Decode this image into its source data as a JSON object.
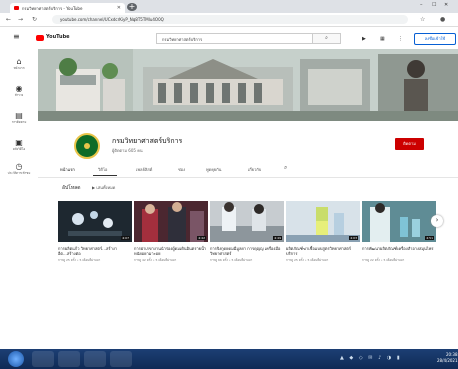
{
  "browser": {
    "tab_title": "กรมวิทยาศาสตร์บริการ - YouTube",
    "url": "youtube.com/channel/UCxdcrKiyP_Nq8T5TMlu4O0Q"
  },
  "youtube": {
    "logo_text": "YouTube",
    "search_value": "กรมวิทยาศาสตร์บริการ",
    "signin_label": "ลงชื่อเข้าใช้"
  },
  "sidebar": {
    "items": [
      {
        "label": "หน้าแรก",
        "icon": "home-icon"
      },
      {
        "label": "สำรวจ",
        "icon": "explore-icon"
      },
      {
        "label": "การติดตาม",
        "icon": "subscriptions-icon"
      },
      {
        "label": "คลังวิดีโอ",
        "icon": "library-icon"
      },
      {
        "label": "ประวัติการเข้าชม",
        "icon": "history-icon"
      }
    ]
  },
  "channel": {
    "name": "กรมวิทยาศาสตร์บริการ",
    "subscribers": "ผู้ติดตาม 605 คน",
    "subscribe_label": "ติดตาม",
    "brand_color": "#cc0000"
  },
  "tabs": [
    "หน้าแรก",
    "วิดีโอ",
    "เพลย์ลิสต์",
    "ช่อง",
    "พูดคุยกัน",
    "เกี่ยวกับ"
  ],
  "section": {
    "title": "อัปโหลด",
    "play_all": "เล่นทั้งหมด"
  },
  "videos": [
    {
      "title": "การผลิตแก้ว วิทยาศาสตร์...สร้างาอีต...สร้างต่อ",
      "duration": "4:07",
      "meta": "การดู 25 ครั้ง • 5 เดือนที่ผ่านมา"
    },
    {
      "title": "การผ่าเรขางานนำร่องผู้ดมเดินอินตรายน้ำหนัยอยามาะอย",
      "duration": "4:42",
      "meta": "การดู 42 ครั้ง • 5 เดือนที่ผ่านมา"
    },
    {
      "title": "การจิงกุดยดมมีมูลยา การดุญญ เครื่องมือวิทยาศาสตร์",
      "duration": "4:49",
      "meta": "การดู 66 ครั้ง • 5 เดือนที่ผ่านมา"
    },
    {
      "title": "ผลิตภัณฑ์ฆ่าเชื้อแบบสูตรวิทยาศาสตร์บริการ",
      "duration": "4:03",
      "meta": "การดู 25 ครั้ง • 5 เดือนที่ผ่านมา"
    },
    {
      "title": "การพัฒนาผลิตภัณฑ์เครื่องสำอางสมุนไพร",
      "duration": "4:51",
      "meta": "การดู 22 ครั้ง • 5 เดือนที่ผ่านมา"
    }
  ],
  "taskbar": {
    "time": "20:38",
    "date": "28/4/2021"
  }
}
